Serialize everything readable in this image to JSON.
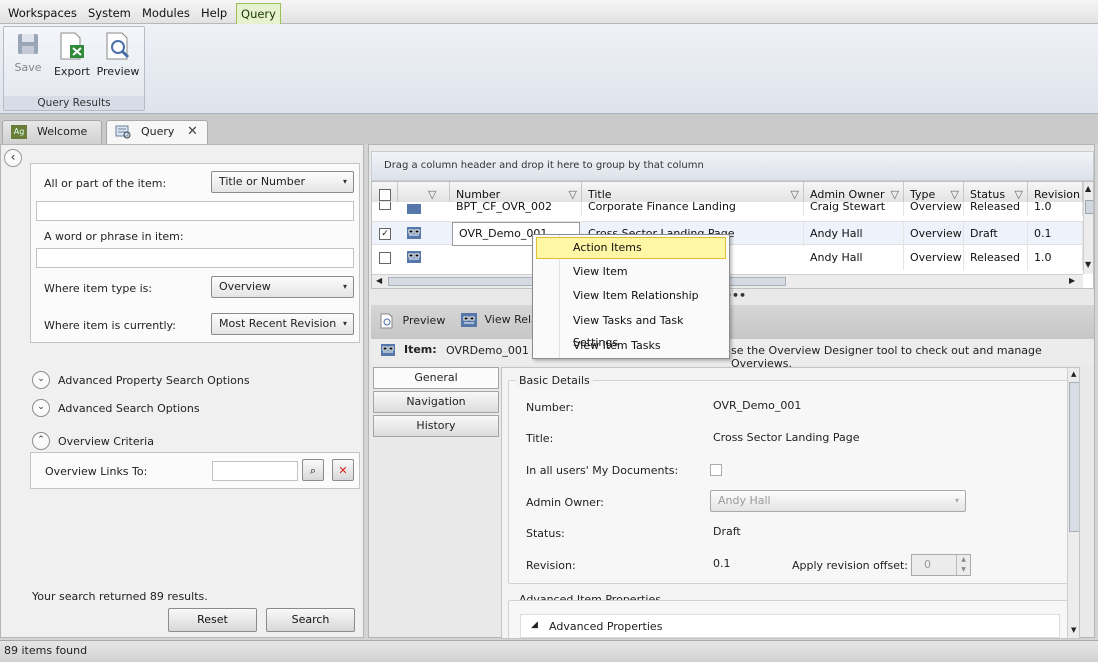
{
  "menubar": {
    "items": [
      "Workspaces",
      "System",
      "Modules",
      "Help"
    ],
    "active_tab": "Query"
  },
  "ribbon": {
    "buttons": {
      "save": "Save",
      "export": "Export",
      "preview": "Preview"
    },
    "group_label": "Query Results"
  },
  "doc_tabs": [
    {
      "label": "Welcome",
      "icon": "ag-logo-icon"
    },
    {
      "label": "Query",
      "icon": "query-icon",
      "closable": true
    }
  ],
  "search": {
    "item_label": "All or part of the item:",
    "item_select": "Title or Number",
    "item_value": "",
    "phrase_label": "A word or phrase in item:",
    "phrase_value": "",
    "type_label": "Where item type is:",
    "type_select": "Overview",
    "current_label": "Where item is currently:",
    "current_select": "Most Recent Revision"
  },
  "expanders": {
    "advanced_property": "Advanced Property Search Options",
    "advanced_search": "Advanced Search Options",
    "overview_criteria": "Overview Criteria",
    "overview_links_label": "Overview Links To:",
    "overview_links_value": ""
  },
  "results": {
    "summary": "Your search returned 89 results.",
    "reset": "Reset",
    "search": "Search"
  },
  "grid": {
    "group_hint": "Drag a column header and drop it here to group by that column",
    "columns": [
      "Number",
      "Title",
      "Admin Owner",
      "Type",
      "Status",
      "Revision"
    ],
    "rows": [
      {
        "checked": false,
        "number": "BPT_CF_OVR_002",
        "title": "Corporate Finance Landing",
        "owner": "Craig Stewart",
        "type": "Overview",
        "status": "Released",
        "revision": "1.0"
      },
      {
        "checked": true,
        "number": "OVR_Demo_001",
        "title": "Cross Sector Landing Page",
        "owner": "Andy Hall",
        "type": "Overview",
        "status": "Draft",
        "revision": "0.1"
      },
      {
        "checked": false,
        "number": "",
        "title": "",
        "owner": "Andy Hall",
        "type": "Overview",
        "status": "Released",
        "revision": "1.0"
      }
    ],
    "splitter_dots": "•••"
  },
  "sub_toolbar": {
    "preview": "Preview",
    "view_relationship": "View Relat"
  },
  "item_strip": {
    "label": "Item:",
    "value": "OVRDemo_001 :",
    "hint": "se the Overview Designer tool to check out and manage Overviews."
  },
  "detail_tabs": [
    "General",
    "Navigation",
    "History"
  ],
  "detail": {
    "basic_details_legend": "Basic Details",
    "number_label": "Number:",
    "number_value": "OVR_Demo_001",
    "title_label": "Title:",
    "title_value": "Cross Sector Landing Page",
    "mydocs_label": "In all users' My Documents:",
    "owner_label": "Admin Owner:",
    "owner_value": "Andy Hall",
    "status_label": "Status:",
    "status_value": "Draft",
    "revision_label": "Revision:",
    "revision_value": "0.1",
    "offset_label": "Apply revision offset:",
    "offset_value": "0",
    "advanced_legend": "Advanced Item Properties",
    "advanced_group": "Advanced Properties"
  },
  "context_menu": {
    "items": [
      "Action Items",
      "View Item",
      "View Item Relationship",
      "View Tasks and Task Settings",
      "View Item Tasks"
    ],
    "highlighted": 0
  },
  "statusbar": {
    "text": "89 items found"
  },
  "colors": {
    "active_menu": "#e6f1cf",
    "menu_highlight": "#fff6a6",
    "clear_red": "#d22"
  }
}
